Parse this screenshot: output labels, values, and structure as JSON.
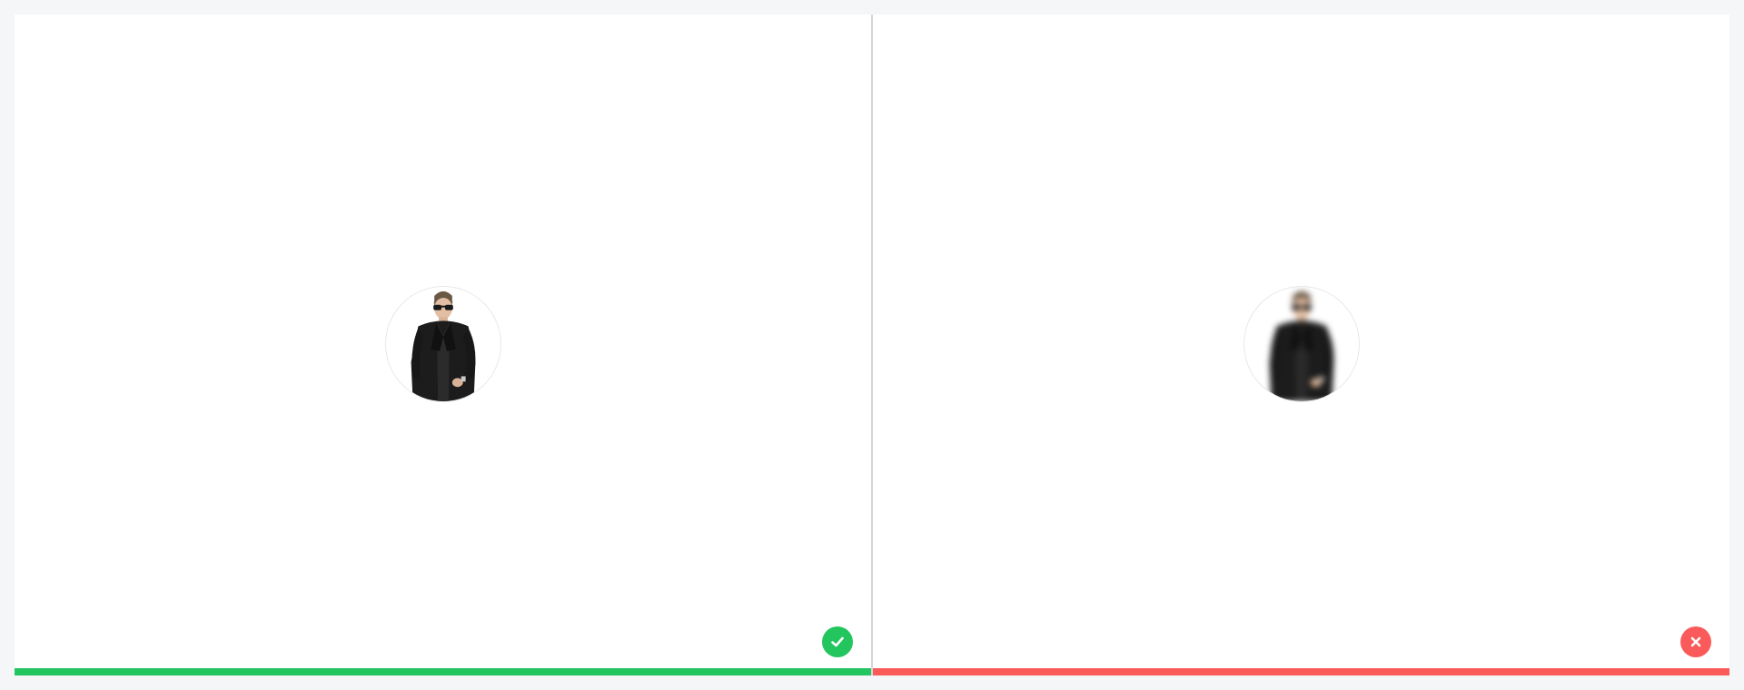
{
  "comparison": {
    "good": {
      "status": "correct",
      "icon": "check-icon",
      "accent_color": "#22c55e"
    },
    "bad": {
      "status": "incorrect",
      "icon": "x-icon",
      "accent_color": "#fb5a5a"
    }
  },
  "avatar": {
    "subject": "man-in-black-suit-with-sunglasses"
  }
}
